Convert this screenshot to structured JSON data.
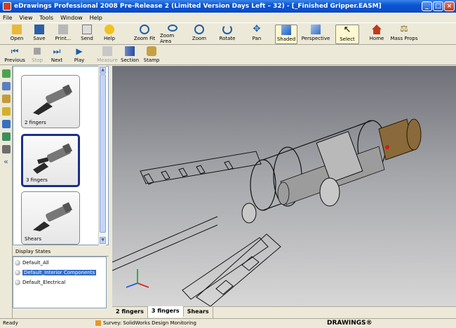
{
  "window": {
    "title": "eDrawings Professional 2008 Pre-Release 2   (Limited Version Days Left – 32) - [_Finished Gripper.EASM]"
  },
  "menu": [
    "File",
    "View",
    "Tools",
    "Window",
    "Help"
  ],
  "toolbar": [
    {
      "label": "Open",
      "icon": "folder-icon"
    },
    {
      "label": "Save",
      "icon": "save-icon"
    },
    {
      "label": "Print...",
      "icon": "print-icon"
    },
    {
      "label": "Send",
      "icon": "send-icon"
    },
    {
      "label": "Help",
      "icon": "help-icon"
    },
    {
      "label": "Zoom Fit",
      "icon": "zoom-fit-icon"
    },
    {
      "label": "Zoom Area",
      "icon": "zoom-area-icon"
    },
    {
      "label": "Zoom",
      "icon": "zoom-icon"
    },
    {
      "label": "Rotate",
      "icon": "rotate-icon"
    },
    {
      "label": "Pan",
      "icon": "pan-icon"
    },
    {
      "label": "Shaded",
      "icon": "shaded-icon"
    },
    {
      "label": "Perspective",
      "icon": "perspective-icon"
    },
    {
      "label": "Select",
      "icon": "select-icon"
    },
    {
      "label": "Home",
      "icon": "home-icon"
    },
    {
      "label": "Mass Props",
      "icon": "mass-props-icon"
    }
  ],
  "toolbar2": [
    {
      "label": "Previous",
      "icon": "previous-icon"
    },
    {
      "label": "Stop",
      "icon": "stop-icon"
    },
    {
      "label": "Next",
      "icon": "next-icon"
    },
    {
      "label": "Play",
      "icon": "play-icon"
    },
    {
      "label": "Measure",
      "icon": "measure-icon"
    },
    {
      "label": "Section",
      "icon": "section-icon"
    },
    {
      "label": "Stamp",
      "icon": "stamp-icon"
    }
  ],
  "configs": [
    {
      "label": "2 fingers"
    },
    {
      "label": "3 fingers"
    },
    {
      "label": "Shears"
    }
  ],
  "display_states": {
    "header": "Display States",
    "items": [
      "Default_All",
      "Default_Interior Components",
      "Default_Electrical"
    ]
  },
  "tabs": [
    "2 fingers",
    "3 fingers",
    "Shears"
  ],
  "status": {
    "left": "Ready",
    "survey": "Survey: SolidWorks Design Monitoring",
    "brand": "DRAWINGS®"
  },
  "colors": {
    "titlebar": "#0a4fcb",
    "selection": "#316ac5"
  }
}
